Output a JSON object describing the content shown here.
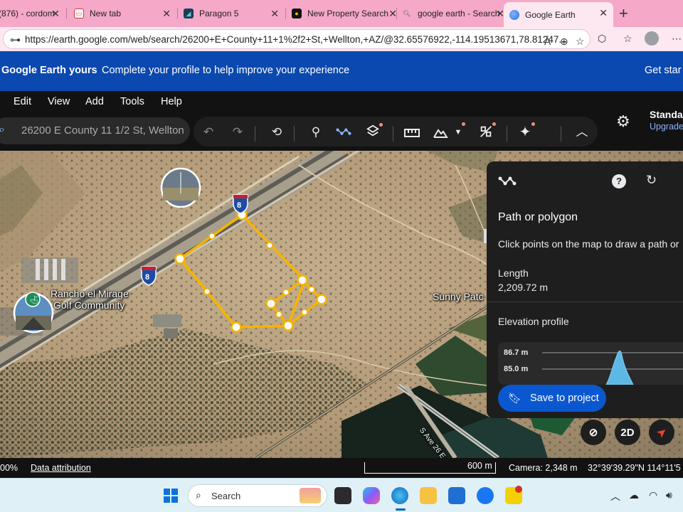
{
  "browser": {
    "tabs": [
      {
        "label": "(876) - cordom",
        "favicon": "mail-icon",
        "active": false
      },
      {
        "label": "New tab",
        "favicon": "new-tab-icon",
        "active": false
      },
      {
        "label": "Paragon 5",
        "favicon": "paragon-icon",
        "active": false
      },
      {
        "label": "New Property Search",
        "favicon": "property-icon",
        "active": false
      },
      {
        "label": "google earth - Search",
        "favicon": "search-icon",
        "active": false
      },
      {
        "label": "Google Earth",
        "favicon": "google-earth-icon",
        "active": true
      }
    ],
    "url": "https://earth.google.com/web/search/26200+E+County+11+1%2f2+St,+Wellton,+AZ/@32.65576922,-114.19513671,78.81247..."
  },
  "banner": {
    "brand": "Google Earth yours",
    "message": "Complete your profile to help improve your experience",
    "cta": "Get star"
  },
  "menu": [
    "Edit",
    "View",
    "Add",
    "Tools",
    "Help"
  ],
  "search": {
    "value": "26200 E County 11 1/2 St, Wellton"
  },
  "account": {
    "plan": "Standa",
    "upgrade": "Upgrade"
  },
  "map": {
    "labels": {
      "golf": "Rancho el Mirage Golf Community",
      "golf_line1": "Rancho el Mirage",
      "golf_line2": "Golf Community",
      "sunny": "Sunny Patc",
      "road": "S Ave 26 E",
      "interstate": "8"
    },
    "accent": "#f5b400"
  },
  "panel": {
    "title": "Path or polygon",
    "instruction": "Click points on the map to draw a path or",
    "length_label": "Length",
    "length_value": "2,209.72 m",
    "elevation_label": "Elevation profile",
    "elev_ticks": [
      "86.7 m",
      "85.0 m"
    ],
    "save_label": "Save to project"
  },
  "map_controls": {
    "view_2d": "2D"
  },
  "status": {
    "zoom_pct": "00%",
    "attribution": "Data attribution",
    "scale": "600 m",
    "camera": "Camera: 2,348 m",
    "coords": "32°39'39.29\"N 114°11'5"
  },
  "taskbar": {
    "search_label": "Search"
  }
}
